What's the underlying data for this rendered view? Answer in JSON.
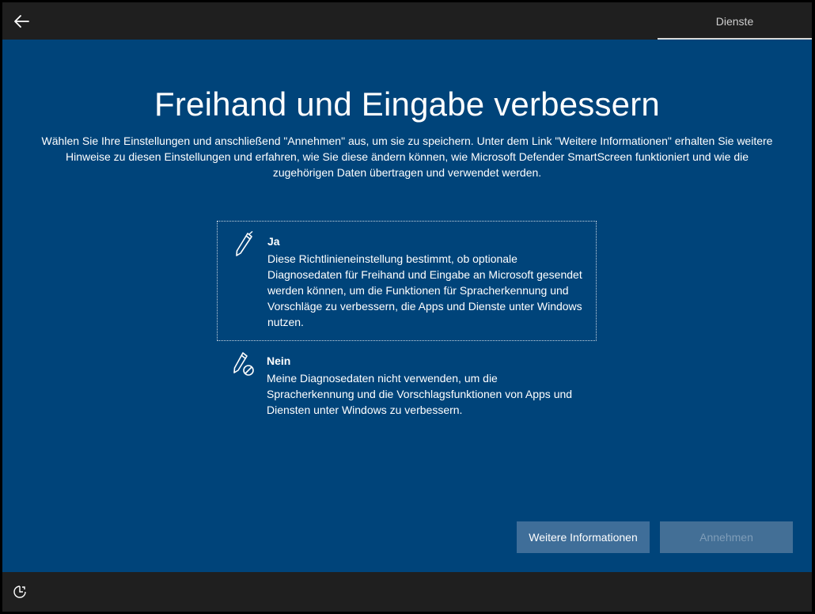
{
  "header": {
    "back_icon": "arrow-left-icon",
    "step_label": "Dienste"
  },
  "main": {
    "title": "Freihand und Eingabe verbessern",
    "description": "Wählen Sie Ihre Einstellungen und anschließend \"Annehmen\" aus, um sie zu speichern. Unter dem Link \"Weitere Informationen\" erhalten Sie weitere Hinweise zu diesen Einstellungen und erfahren, wie Sie diese ändern können, wie Microsoft Defender SmartScreen funktioniert und wie die zugehörigen Daten übertragen und verwendet werden.",
    "options": [
      {
        "title": "Ja",
        "text": "Diese Richtlinieneinstellung bestimmt, ob optionale Diagnosedaten für Freihand und Eingabe an Microsoft gesendet werden können, um die Funktionen für Spracherkennung und Vorschläge zu verbessern, die Apps und Dienste unter Windows nutzen.",
        "icon": "pen-icon",
        "selected": true
      },
      {
        "title": "Nein",
        "text": "Meine Diagnosedaten nicht verwenden, um die Spracherkennung und die Vorschlagsfunktionen von Apps und Diensten unter Windows zu verbessern.",
        "icon": "pen-disabled-icon",
        "selected": false
      }
    ],
    "buttons": {
      "more_info": "Weitere Informationen",
      "accept": "Annehmen"
    }
  },
  "footer": {
    "accessibility_icon": "ease-of-access-icon"
  },
  "colors": {
    "background": "#00447a",
    "chrome": "#1f1f1f",
    "button": "#3f6e99",
    "button_disabled_text": "#7f9db8"
  }
}
